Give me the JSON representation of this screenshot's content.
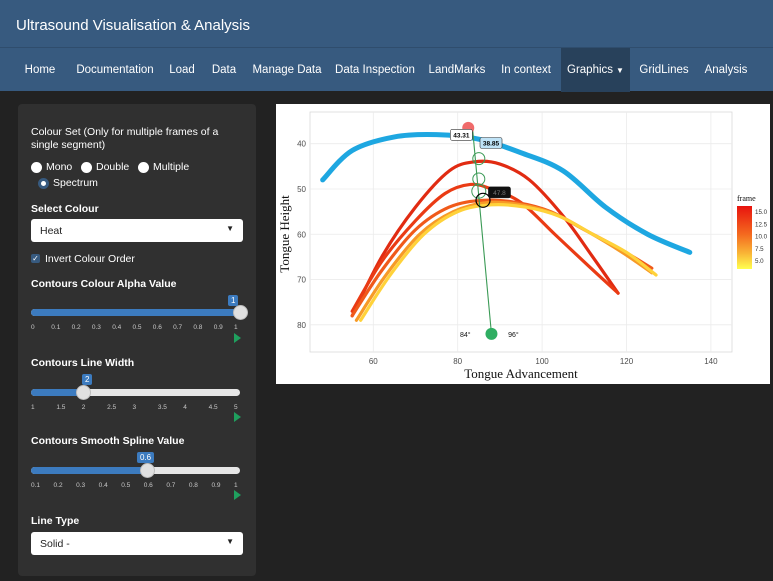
{
  "app": {
    "title": "Ultrasound Visualisation & Analysis"
  },
  "nav": {
    "items": [
      {
        "label": "Home"
      },
      {
        "label": "Documentation"
      },
      {
        "label": "Load"
      },
      {
        "label": "Data"
      },
      {
        "label": "Manage Data"
      },
      {
        "label": "Data Inspection"
      },
      {
        "label": "LandMarks"
      },
      {
        "label": "In context"
      },
      {
        "label": "Graphics",
        "active": true
      },
      {
        "label": "GridLines"
      },
      {
        "label": "Analysis"
      }
    ]
  },
  "sidebar": {
    "colour_set_label": "Colour Set (Only for multiple frames of a single segment)",
    "radios": {
      "mono": "Mono",
      "double": "Double",
      "multiple": "Multiple",
      "spectrum": "Spectrum",
      "selected": "Spectrum"
    },
    "select_colour_label": "Select Colour",
    "select_colour_value": "Heat",
    "invert_label": "Invert Colour Order",
    "invert_checked": true,
    "alpha": {
      "label": "Contours Colour Alpha Value",
      "value": "1",
      "fraction": 1.0,
      "ticks": [
        "0",
        "0.1",
        "0.2",
        "0.3",
        "0.4",
        "0.5",
        "0.6",
        "0.7",
        "0.8",
        "0.9",
        "1"
      ]
    },
    "width": {
      "label": "Contours Line Width",
      "value": "2",
      "fraction": 0.25,
      "ticks": [
        "1",
        "1.5",
        "2",
        "2.5",
        "3",
        "3.5",
        "4",
        "4.5",
        "5"
      ]
    },
    "spline": {
      "label": "Contours Smooth Spline Value",
      "value": "0.6",
      "fraction": 0.5556,
      "ticks": [
        "0.1",
        "0.2",
        "0.3",
        "0.4",
        "0.5",
        "0.6",
        "0.7",
        "0.8",
        "0.9",
        "1"
      ]
    },
    "line_type_label": "Line Type",
    "line_type_value": "Solid -"
  },
  "plot": {
    "xlabel": "Tongue Advancement",
    "ylabel": "Tongue Height",
    "xticks": [
      "60",
      "80",
      "100",
      "120",
      "140"
    ],
    "yticks": [
      "40",
      "50",
      "60",
      "70",
      "80"
    ],
    "legend_title": "frame",
    "legend_ticks": [
      "15.0",
      "12.5",
      "10.0",
      "7.5",
      "5.0"
    ],
    "annotations": {
      "a1": "43.31",
      "a2": "38.85",
      "a3": "47.8",
      "angle_left": "84°",
      "angle_right": "96°"
    }
  },
  "chart_data": {
    "type": "line",
    "xlabel": "Tongue Advancement",
    "ylabel": "Tongue Height",
    "xlim": [
      45,
      145
    ],
    "ylim": [
      86,
      33
    ],
    "xticks": [
      60,
      80,
      100,
      120,
      140
    ],
    "yticks": [
      40,
      50,
      60,
      70,
      80
    ],
    "legend": "right",
    "legend_title": "frame",
    "series": [
      {
        "x": [
          48,
          55,
          65,
          75,
          85,
          95,
          105,
          115,
          125,
          135
        ],
        "y": [
          48,
          41.5,
          38.5,
          38,
          39,
          42,
          46,
          54,
          60,
          64
        ],
        "color": "#1ea7e1"
      },
      {
        "x": [
          55,
          62,
          70,
          78,
          84,
          90,
          97,
          105,
          112,
          118
        ],
        "y": [
          78,
          65,
          54,
          46,
          44,
          44.5,
          48,
          56,
          65,
          73
        ],
        "color": "#e12b12"
      },
      {
        "x": [
          55,
          62,
          70,
          77,
          83,
          88,
          95,
          103,
          111,
          118
        ],
        "y": [
          77,
          66,
          57,
          51,
          49,
          50,
          53,
          60,
          67,
          73
        ],
        "color": "#ea3b14"
      },
      {
        "x": [
          55,
          62,
          70,
          78,
          86,
          94,
          102,
          110,
          118,
          126
        ],
        "y": [
          78,
          68,
          59,
          54,
          52.5,
          53,
          55,
          59,
          63,
          67.5
        ],
        "color": "#f05a1a"
      },
      {
        "x": [
          56,
          63,
          71,
          79,
          87,
          95,
          103,
          111,
          119,
          126
        ],
        "y": [
          79,
          69,
          60,
          55,
          53,
          53.5,
          55.5,
          59.5,
          64,
          68.5
        ],
        "color": "#f79a27"
      },
      {
        "x": [
          57,
          64,
          72,
          80,
          88,
          96,
          104,
          112,
          120,
          127
        ],
        "y": [
          79,
          69,
          60,
          55,
          53.5,
          54,
          56,
          60,
          64,
          69
        ],
        "color": "#ffd23a"
      }
    ]
  }
}
